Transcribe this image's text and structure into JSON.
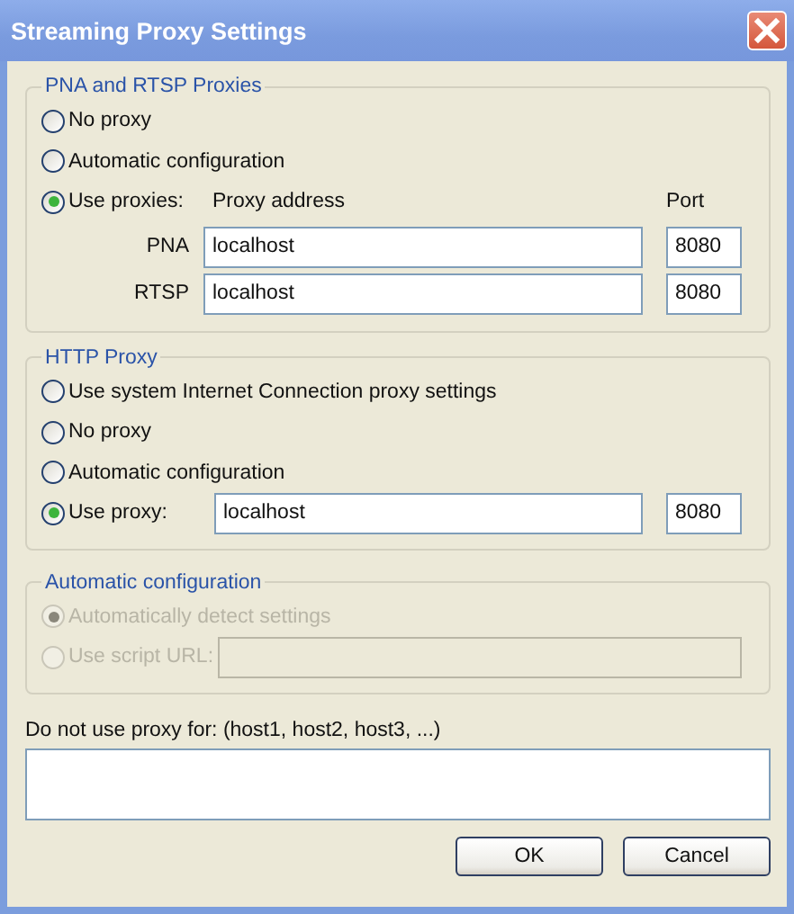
{
  "window": {
    "title": "Streaming Proxy Settings"
  },
  "pna_rtsp_proxies": {
    "title": "PNA and RTSP Proxies",
    "address_heading": "Proxy address",
    "port_heading": "Port",
    "options": [
      {
        "label": "No proxy",
        "selected": false
      },
      {
        "label": "Automatic configuration",
        "selected": false
      },
      {
        "label": "Use proxies:",
        "selected": true
      }
    ],
    "proxies": [
      {
        "label": "PNA",
        "address": "localhost",
        "port": "8080"
      },
      {
        "label": "RTSP",
        "address": "localhost",
        "port": "8080"
      }
    ]
  },
  "http_proxy": {
    "title": "HTTP Proxy",
    "address": "localhost",
    "port": "8080",
    "options": [
      {
        "label": "Use system Internet Connection proxy settings",
        "selected": false
      },
      {
        "label": "No proxy",
        "selected": false
      },
      {
        "label": "Automatic configuration",
        "selected": false
      },
      {
        "label": "Use proxy:",
        "selected": true
      }
    ]
  },
  "automatic_configuration": {
    "title": "Automatic configuration",
    "disabled": true,
    "options": [
      {
        "label": "Automatically detect settings",
        "selected": true
      },
      {
        "label": "Use script URL:",
        "selected": false
      }
    ]
  },
  "bypass": {
    "label": "Do not use proxy for: (host1, host2, host3, ...)"
  },
  "buttons": [
    "OK",
    "Cancel"
  ]
}
